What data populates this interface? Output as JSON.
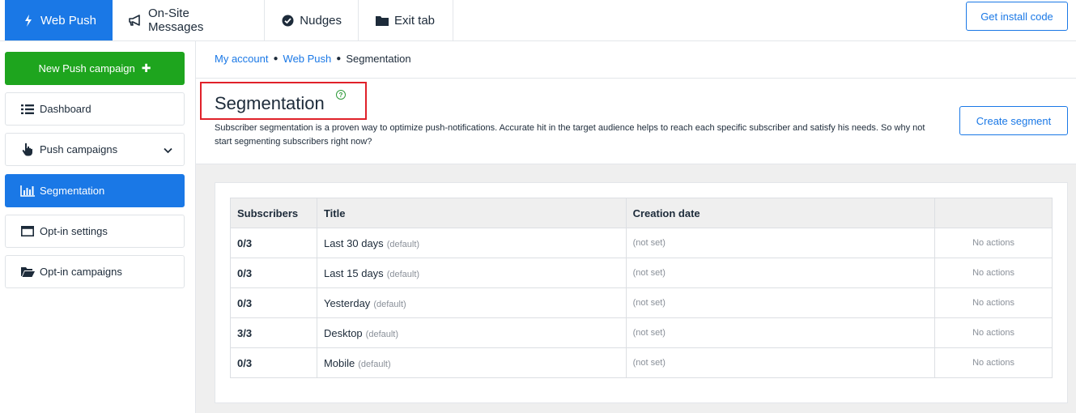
{
  "nav": {
    "tabs": [
      {
        "label": "Web Push",
        "icon": "bolt-icon",
        "active": true
      },
      {
        "label": "On-Site Messages",
        "icon": "megaphone-icon",
        "active": false
      },
      {
        "label": "Nudges",
        "icon": "check-circle-icon",
        "active": false
      },
      {
        "label": "Exit tab",
        "icon": "folder-icon",
        "active": false
      }
    ],
    "install_button": "Get install code"
  },
  "sidebar": {
    "new_campaign": "New Push campaign",
    "items": [
      {
        "label": "Dashboard",
        "icon": "list-icon"
      },
      {
        "label": "Push campaigns",
        "icon": "hand-pointer-icon"
      },
      {
        "label": "Segmentation",
        "icon": "bar-chart-icon",
        "active": true
      },
      {
        "label": "Opt-in settings",
        "icon": "window-icon"
      },
      {
        "label": "Opt-in campaigns",
        "icon": "folder-open-icon"
      }
    ]
  },
  "breadcrumb": {
    "items": [
      "My account",
      "Web Push",
      "Segmentation"
    ]
  },
  "page": {
    "title": "Segmentation",
    "description": "Subscriber segmentation is a proven way to optimize push-notifications. Accurate hit in the target audience helps to reach each specific subscriber and satisfy his needs. So why not start segmenting subscribers right now?",
    "create_button": "Create segment",
    "help": "?"
  },
  "table": {
    "headers": [
      "Subscribers",
      "Title",
      "Creation date",
      ""
    ],
    "rows": [
      {
        "subscribers": "0/3",
        "title": "Last 30 days",
        "tag": "(default)",
        "date": "(not set)",
        "actions": "No actions"
      },
      {
        "subscribers": "0/3",
        "title": "Last 15 days",
        "tag": "(default)",
        "date": "(not set)",
        "actions": "No actions"
      },
      {
        "subscribers": "0/3",
        "title": "Yesterday",
        "tag": "(default)",
        "date": "(not set)",
        "actions": "No actions"
      },
      {
        "subscribers": "3/3",
        "title": "Desktop",
        "tag": "(default)",
        "date": "(not set)",
        "actions": "No actions"
      },
      {
        "subscribers": "0/3",
        "title": "Mobile",
        "tag": "(default)",
        "date": "(not set)",
        "actions": "No actions"
      }
    ]
  },
  "colors": {
    "primary": "#1a78e6",
    "success": "#1ea51e",
    "highlight": "#e0212a"
  }
}
